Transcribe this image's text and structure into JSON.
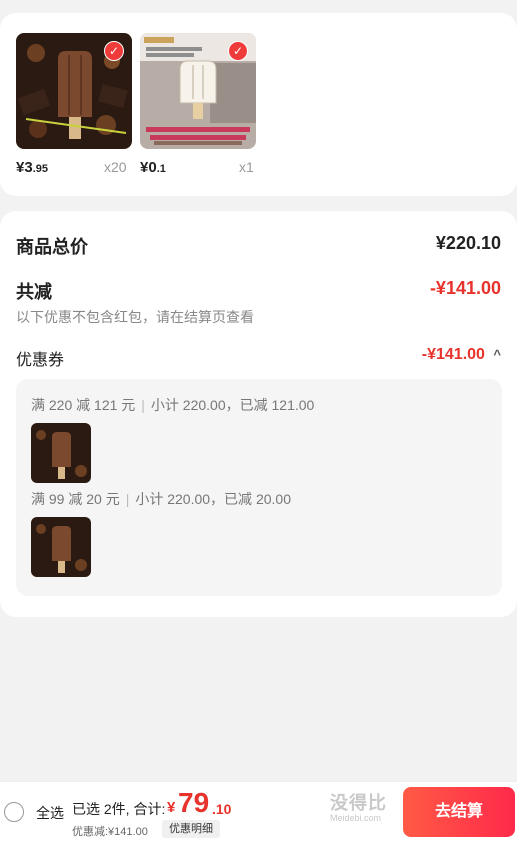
{
  "items": [
    {
      "price_symbol": "¥",
      "price_int": "3",
      "price_dec": ".95",
      "qty": "x20",
      "checked": true,
      "image": "chocolate-popsicle"
    },
    {
      "price_symbol": "¥",
      "price_int": "0",
      "price_dec": ".1",
      "qty": "x1",
      "checked": true,
      "image": "cream-popsicle-promo"
    }
  ],
  "summary": {
    "total_label": "商品总价",
    "total_value": "¥220.10",
    "reduce_label": "共减",
    "reduce_value": "-¥141.00",
    "note": "以下优惠不包含红包，请在结算页查看",
    "coupon_label": "优惠券",
    "coupon_value": "-¥141.00",
    "coupon_chevron": "^"
  },
  "coupons": [
    {
      "rule": "满 220 减 121 元",
      "detail": "小计 220.00，已减 121.00"
    },
    {
      "rule": "满 99 减 20 元",
      "detail": "小计 220.00，已减 20.00"
    }
  ],
  "bottom": {
    "select_all": "全选",
    "selected_text": "已选 2件, 合计:",
    "total_symbol": "¥",
    "total_int": "79",
    "total_dec": ".10",
    "discount_text": "优惠减:¥141.00",
    "detail_button": "优惠明细",
    "checkout_button": "去结算",
    "watermark": "没得比",
    "watermark_sub": "Meidebi.com"
  },
  "colors": {
    "accent": "#e8322c",
    "check": "#f03b3b"
  }
}
